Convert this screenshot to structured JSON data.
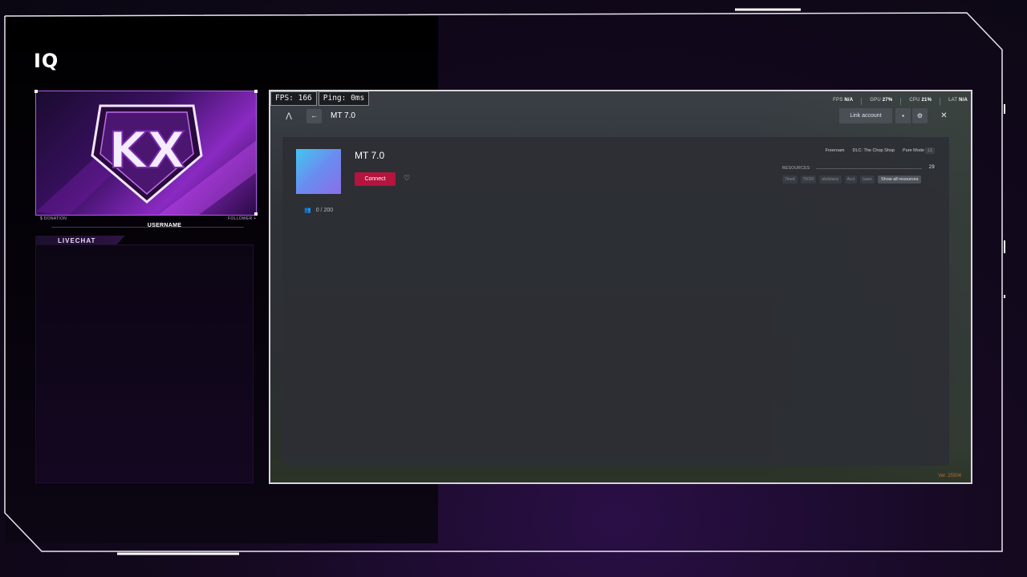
{
  "overlay": {
    "logo": "IQ",
    "cam_left_caption": "$ DONATION",
    "cam_right_caption": "FOLLOWER +",
    "emblem_text": "KX",
    "username": "USERNAME",
    "livechat_label": "LIVECHAT"
  },
  "game": {
    "perf": {
      "fps": "FPS: 166",
      "ping": "Ping: 0ms"
    },
    "sysstats": {
      "fps_label": "FPS",
      "fps_value": "N/A",
      "gpu_label": "GPU",
      "gpu_value": "27%",
      "cpu_label": "CPU",
      "cpu_value": "21%",
      "lat_label": "LAT",
      "lat_value": "N/A"
    },
    "topbar": {
      "brand_icon": "Λ",
      "back_icon": "←",
      "title": "MT 7.0",
      "link_account": "Link account",
      "cart_icon": "▪",
      "gear_icon": "⚙",
      "close_icon": "✕"
    },
    "server": {
      "name": "MT 7.0",
      "connect_label": "Connect",
      "fav_icon": "♡",
      "players": "0 / 200",
      "players_icon": "👥"
    },
    "tags": {
      "freeroam": "Freeroam",
      "dlc": "DLC: The Chop Shop",
      "pure_mode": "Pure Mode",
      "pure_mode_pill": "L1"
    },
    "resources": {
      "header": "RESOURCES",
      "count": "29",
      "chips": [
        "7med",
        "75020",
        "abdulaziz",
        "Acct",
        "basic"
      ],
      "show_all": "Show all resources"
    },
    "version": "Ver. 25504"
  },
  "colors": {
    "accent_purple": "#b45cf0",
    "connect_red": "#b4143e",
    "version_orange": "#c4692c"
  }
}
